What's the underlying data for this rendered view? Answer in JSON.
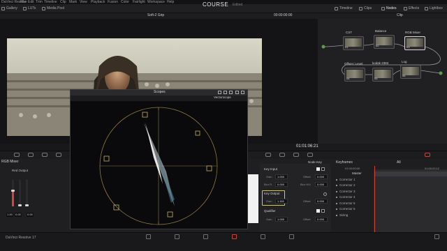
{
  "menubar": {
    "items": [
      "DaVinci Resolve",
      "File",
      "Edit",
      "Trim",
      "Timeline",
      "Clip",
      "Mark",
      "View",
      "Playback",
      "Fusion",
      "Color",
      "Fairlight",
      "Workspace",
      "Help"
    ]
  },
  "toolbar": {
    "left": [
      "Gallery",
      "LUTs",
      "Media Pool"
    ],
    "project_title": "COURSE",
    "project_state": "Edited",
    "right": [
      "Timeline",
      "Clips",
      "Nodes",
      "Effects",
      "Lightbox"
    ]
  },
  "viewer": {
    "title": "Soft-2 Grip",
    "timecode_top": "00:00:00:00",
    "timecode_bottom": "01:01:06:21"
  },
  "node_panel": {
    "mode": "Clip",
    "nodes": [
      {
        "label": "CST",
        "num": "01"
      },
      {
        "label": "Balance",
        "num": "02"
      },
      {
        "label": "RGB Mixer",
        "num": "03"
      },
      {
        "label": "Offset / Level",
        "num": "04"
      },
      {
        "label": "kodak 2383",
        "num": "05"
      },
      {
        "label": "Log",
        "num": "06"
      }
    ]
  },
  "mixer": {
    "title": "RGB Mixer",
    "channel_label": "Red Output",
    "channels": [
      {
        "value": "1.00",
        "color": "#d3433a",
        "level": 0.55
      },
      {
        "value": "0.00",
        "color": "#39a04a",
        "level": 0.0
      },
      {
        "value": "0.00",
        "color": "#3b6fd0",
        "level": 0.0
      }
    ]
  },
  "scopes": {
    "title": "Scopes",
    "mode": "Vectorscope"
  },
  "key_panel": {
    "title": "Node Key",
    "key_input": {
      "label": "Key Input",
      "gain_label": "Gain",
      "gain": "1.000",
      "offset_label": "Offset",
      "offset": "0.000",
      "blur_r_label": "Blur R.",
      "blur_r": "0.000",
      "blur_hv_label": "Blur H/V",
      "blur_hv": "0.000"
    },
    "key_output": {
      "label": "Key Output",
      "gain_label": "Gain",
      "gain": "1.161",
      "offset_label": "Offset",
      "offset": "0.000"
    },
    "qualifier": {
      "label": "Qualifier",
      "gain_label": "Gain",
      "gain": "1.000",
      "offset_label": "Offset",
      "offset": "0.000"
    }
  },
  "keyframes": {
    "title": "Keyframes",
    "filter": "All",
    "tc_start": "01:00:00:00",
    "tc_end": "01:00:03:12",
    "master": "Master",
    "rows": [
      "Corrector 1",
      "Corrector 2",
      "Corrector 3",
      "Corrector 4",
      "Corrector 5",
      "Corrector 6",
      "Sizing"
    ]
  },
  "bottom": {
    "app_name": "DaVinci Resolve 17"
  }
}
